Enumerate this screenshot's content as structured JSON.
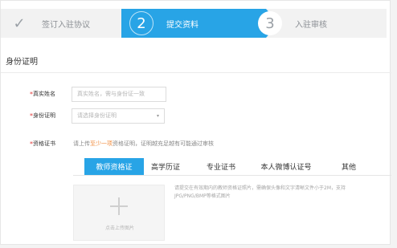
{
  "steps": [
    {
      "label": "签订入驻协议",
      "icon": "check-icon"
    },
    {
      "num": "2",
      "label": "提交资料"
    },
    {
      "num": "3",
      "label": "入驻审核"
    }
  ],
  "section": {
    "title": "身份证明"
  },
  "fields": {
    "name": {
      "required": "*",
      "label": "真实姓名",
      "placeholder": "真实姓名，需与身份证一致"
    },
    "id_proof": {
      "required": "*",
      "label": "身份证明",
      "value": "请选择身份证明",
      "caret": "▾"
    },
    "cert": {
      "required": "*",
      "label": "资格证书"
    }
  },
  "hint": {
    "prefix": "请上传",
    "emphasis": "至少一项",
    "suffix": "资格证明，证明越充足越有可能通过审核"
  },
  "tabs": [
    "教师资格证",
    "高学历证",
    "专业证书",
    "本人微博认证号",
    "其他"
  ],
  "upload": {
    "plus_icon": "plus-icon",
    "text": "点击上传图片",
    "desc": "请提交在有效期内的教师资格证照片，需确保头像和文字清晰文件小于2M，支持JPG/PNG/BMP等格式图片"
  },
  "colors": {
    "accent": "#28a4e6",
    "required": "#e23a3a",
    "emphasis": "#f08a3a"
  }
}
